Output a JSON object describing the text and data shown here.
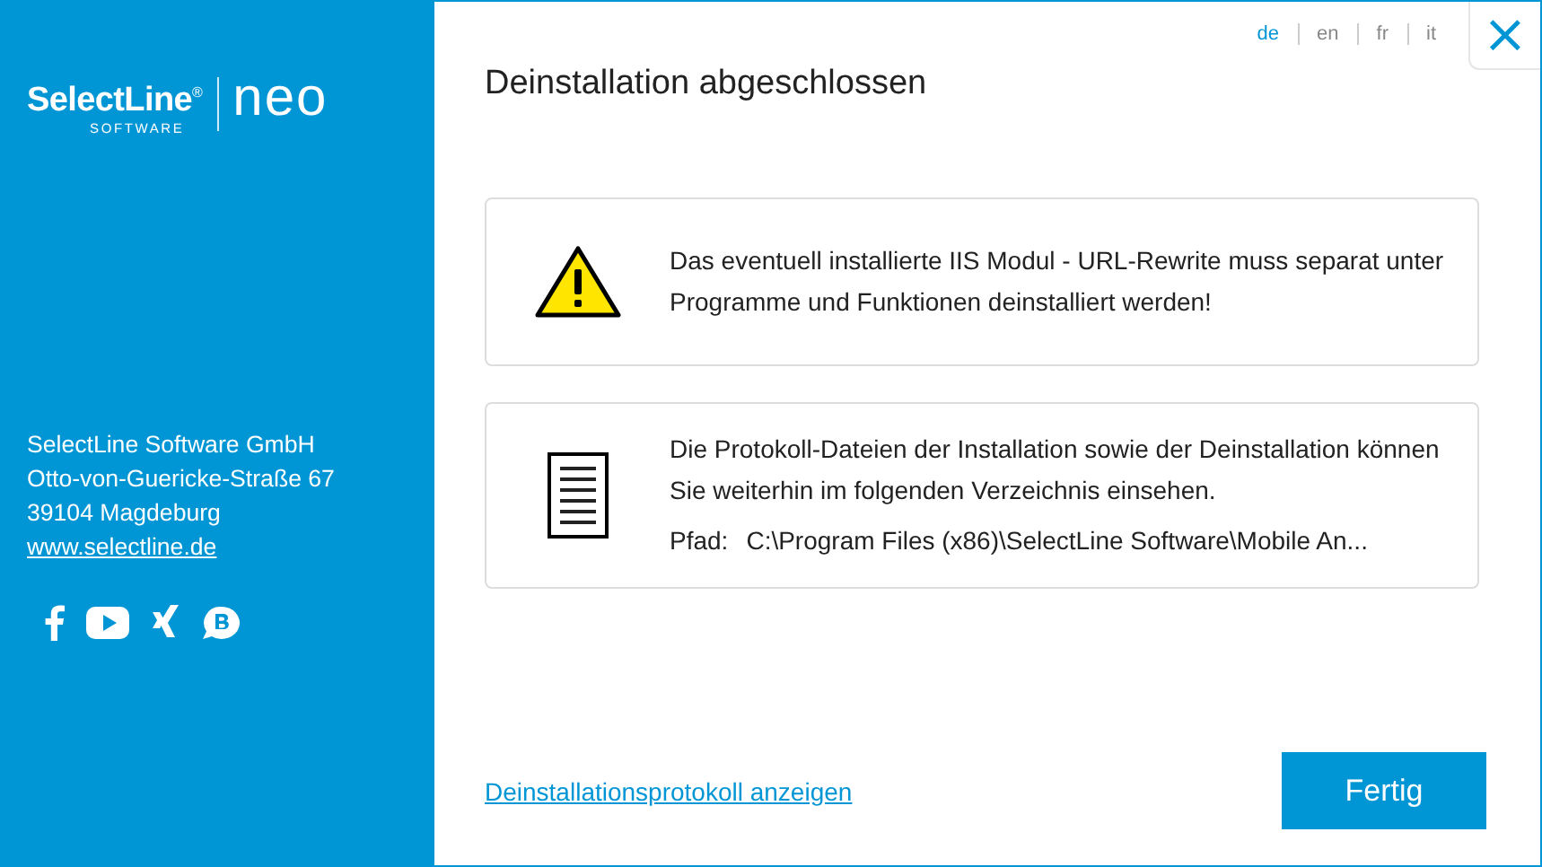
{
  "sidebar": {
    "logo": {
      "brand": "SelectLine",
      "registered": "®",
      "sub": "SOFTWARE",
      "product": "neo"
    },
    "address": [
      "SelectLine Software GmbH",
      "Otto-von-Guericke-Straße 67",
      "39104 Magdeburg"
    ],
    "website": "www.selectline.de",
    "social": [
      {
        "kind": "facebook"
      },
      {
        "kind": "youtube"
      },
      {
        "kind": "xing"
      },
      {
        "kind": "blog"
      }
    ]
  },
  "languages": [
    {
      "label": "de",
      "selected": true
    },
    {
      "label": "en",
      "selected": false
    },
    {
      "label": "fr",
      "selected": false
    },
    {
      "label": "it",
      "selected": false
    }
  ],
  "close": "×",
  "title": "Deinstallation abgeschlossen",
  "messages": [
    {
      "kind": "warning",
      "lines": [
        "Das eventuell installierte IIS Modul - URL-Rewrite muss separat unter Programme und Funktionen deinstalliert werden!"
      ]
    },
    {
      "kind": "document",
      "lines": [
        "Die Protokoll-Dateien der Installation sowie der Deinstallation können Sie weiterhin im folgenden Verzeichnis einsehen."
      ],
      "path_label": "Pfad:",
      "path": "C:\\Program Files (x86)\\SelectLine Software\\Mobile An..."
    }
  ],
  "log_link": "Deinstallationsprotokoll anzeigen",
  "finish_button": "Fertig"
}
